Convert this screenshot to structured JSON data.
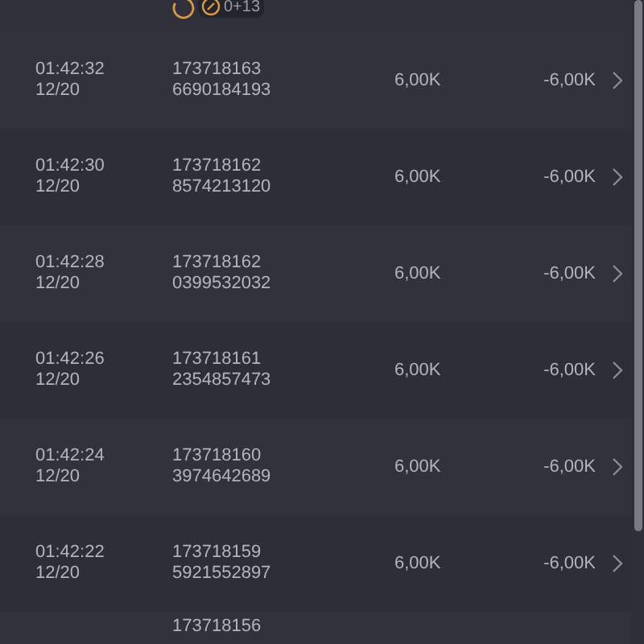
{
  "top_row": {
    "badge": "0+13"
  },
  "rows": [
    {
      "time": "01:42:32",
      "date": "12/20",
      "id_line_1": "173718163",
      "id_line_2": "6690184193",
      "amount": "6,00K",
      "result": "-6,00K"
    },
    {
      "time": "01:42:30",
      "date": "12/20",
      "id_line_1": "173718162",
      "id_line_2": "8574213120",
      "amount": "6,00K",
      "result": "-6,00K"
    },
    {
      "time": "01:42:28",
      "date": "12/20",
      "id_line_1": "173718162",
      "id_line_2": "0399532032",
      "amount": "6,00K",
      "result": "-6,00K"
    },
    {
      "time": "01:42:26",
      "date": "12/20",
      "id_line_1": "173718161",
      "id_line_2": "2354857473",
      "amount": "6,00K",
      "result": "-6,00K"
    },
    {
      "time": "01:42:24",
      "date": "12/20",
      "id_line_1": "173718160",
      "id_line_2": "3974642689",
      "amount": "6,00K",
      "result": "-6,00K"
    },
    {
      "time": "01:42:22",
      "date": "12/20",
      "id_line_1": "173718159",
      "id_line_2": "5921552897",
      "amount": "6,00K",
      "result": "-6,00K"
    }
  ],
  "bottom_row": {
    "id_line_1": "173718156"
  }
}
